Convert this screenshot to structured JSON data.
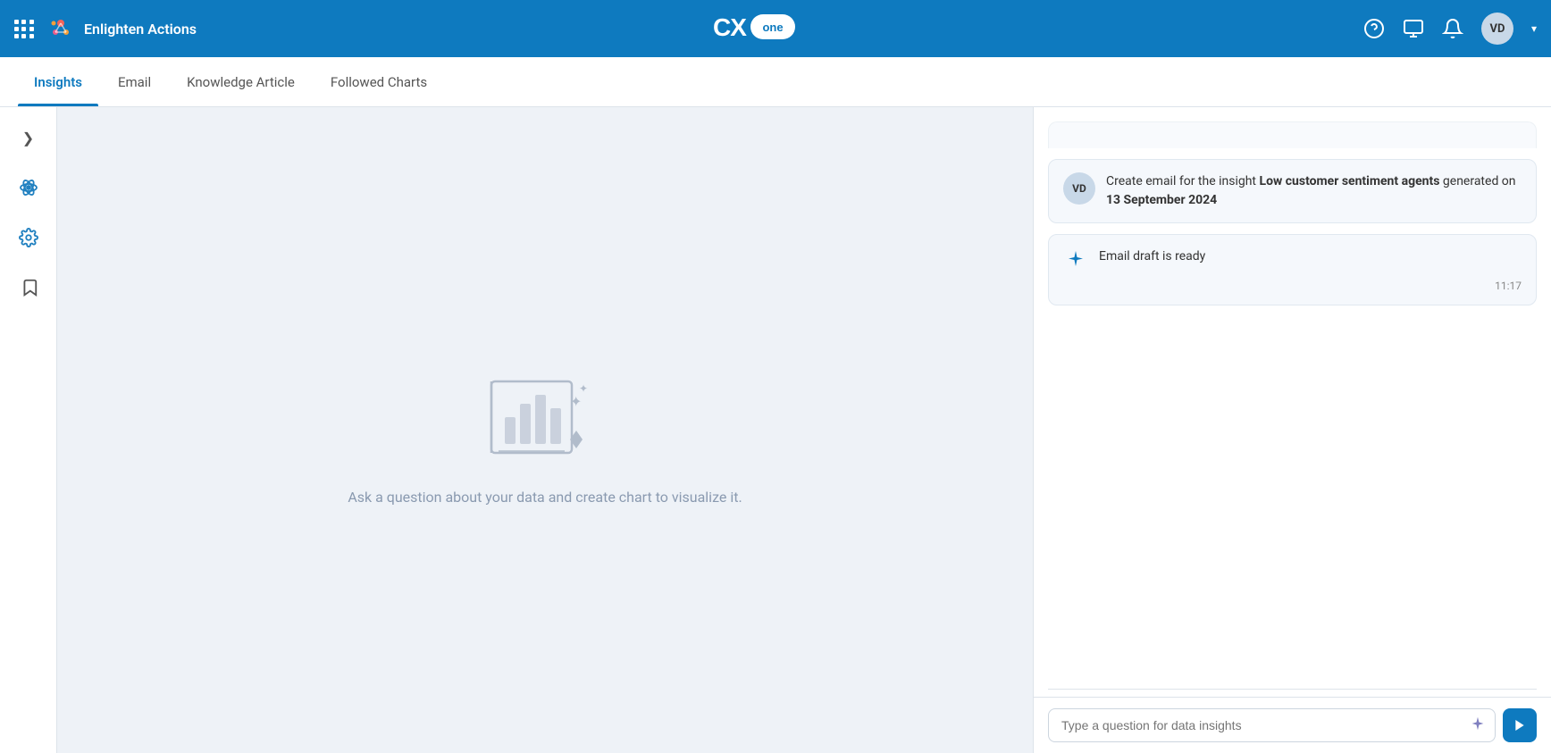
{
  "navbar": {
    "app_name": "Enlighten Actions",
    "logo_text": "CX",
    "logo_badge": "one",
    "help_icon": "?",
    "screen_icon": "🖥",
    "bell_icon": "🔔",
    "avatar_initials": "VD"
  },
  "tabs": [
    {
      "id": "insights",
      "label": "Insights",
      "active": true
    },
    {
      "id": "email",
      "label": "Email",
      "active": false
    },
    {
      "id": "knowledge-article",
      "label": "Knowledge Article",
      "active": false
    },
    {
      "id": "followed-charts",
      "label": "Followed Charts",
      "active": false
    }
  ],
  "sidebar": {
    "icons": [
      {
        "name": "atom-icon",
        "symbol": "⚛"
      },
      {
        "name": "settings-icon",
        "symbol": "⚙"
      },
      {
        "name": "bookmark-icon",
        "symbol": "🔖"
      }
    ],
    "chevron": "❯"
  },
  "empty_state": {
    "text": "Ask a question about your data and create chart to visualize it."
  },
  "chat": {
    "messages": [
      {
        "type": "user",
        "avatar": "VD",
        "text_prefix": "Create email for the insight ",
        "text_bold1": "Low customer sentiment agents",
        "text_middle": " generated on ",
        "text_bold2": "13 September 2024"
      },
      {
        "type": "ai",
        "text": "Email draft is ready",
        "timestamp": "11:17"
      }
    ],
    "input_placeholder": "Type a question for data insights",
    "send_label": "➤"
  }
}
